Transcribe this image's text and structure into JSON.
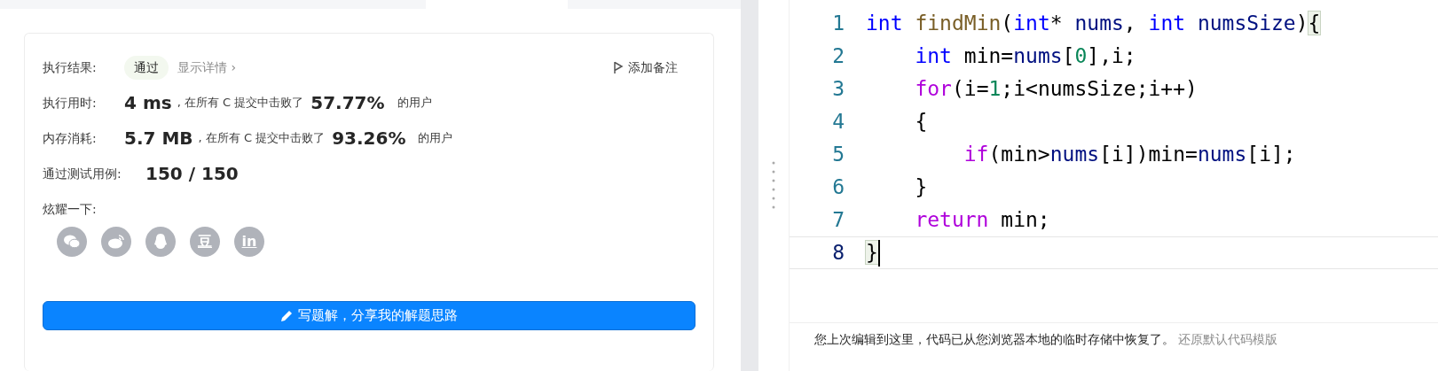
{
  "result": {
    "label": "执行结果:",
    "status": "通过",
    "details_link": "显示详情 ›",
    "add_note": "添加备注"
  },
  "stats": [
    {
      "label": "执行用时:",
      "value": "4 ms",
      "text": ", 在所有 C 提交中击败了",
      "percent": "57.77%",
      "suffix": "的用户"
    },
    {
      "label": "内存消耗:",
      "value": "5.7 MB",
      "text": ", 在所有 C 提交中击败了",
      "percent": "93.26%",
      "suffix": "的用户"
    }
  ],
  "tests": {
    "label": "通过测试用例:",
    "value": "150 / 150"
  },
  "share": {
    "label": "炫耀一下:",
    "icons": [
      {
        "kind": "wechat"
      },
      {
        "kind": "weibo"
      },
      {
        "kind": "qq"
      },
      {
        "kind": "douban",
        "glyph": "豆"
      },
      {
        "kind": "linkedin",
        "glyph": "in"
      }
    ]
  },
  "write_button": "写题解，分享我的解题思路",
  "editor": {
    "lines": [
      {
        "number": "1",
        "active": false,
        "tokens": [
          {
            "kind": "keyword",
            "text": "int"
          },
          {
            "kind": "function",
            "text": " findMin"
          },
          {
            "kind": "plain",
            "text": "("
          },
          {
            "kind": "keyword",
            "text": "int"
          },
          {
            "kind": "plain",
            "text": "* "
          },
          {
            "kind": "variable",
            "text": "nums"
          },
          {
            "kind": "plain",
            "text": ", "
          },
          {
            "kind": "keyword",
            "text": "int"
          },
          {
            "kind": "variable",
            "text": " numsSize"
          },
          {
            "kind": "plain",
            "text": ")"
          },
          {
            "kind": "bracket",
            "text": "{"
          }
        ]
      },
      {
        "number": "2",
        "active": false,
        "tokens": [
          {
            "kind": "keyword",
            "text": "    int"
          },
          {
            "kind": "plain",
            "text": " min="
          },
          {
            "kind": "variable",
            "text": "nums"
          },
          {
            "kind": "plain",
            "text": "["
          },
          {
            "kind": "number",
            "text": "0"
          },
          {
            "kind": "plain",
            "text": "],i;"
          }
        ]
      },
      {
        "number": "3",
        "active": false,
        "tokens": [
          {
            "kind": "control",
            "text": "    for"
          },
          {
            "kind": "plain",
            "text": "(i="
          },
          {
            "kind": "number",
            "text": "1"
          },
          {
            "kind": "plain",
            "text": ";i<numsSize;i++)"
          }
        ]
      },
      {
        "number": "4",
        "active": false,
        "tokens": [
          {
            "kind": "plain",
            "text": "    {"
          }
        ]
      },
      {
        "number": "5",
        "active": false,
        "tokens": [
          {
            "kind": "control",
            "text": "        if"
          },
          {
            "kind": "plain",
            "text": "(min>"
          },
          {
            "kind": "variable",
            "text": "nums"
          },
          {
            "kind": "plain",
            "text": "[i])min="
          },
          {
            "kind": "variable",
            "text": "nums"
          },
          {
            "kind": "plain",
            "text": "[i];"
          }
        ]
      },
      {
        "number": "6",
        "active": false,
        "tokens": [
          {
            "kind": "plain",
            "text": "    }"
          }
        ]
      },
      {
        "number": "7",
        "active": false,
        "tokens": [
          {
            "kind": "control",
            "text": "    return"
          },
          {
            "kind": "plain",
            "text": " min;"
          }
        ]
      },
      {
        "number": "8",
        "active": true,
        "tokens": [
          {
            "kind": "bracket",
            "text": "}"
          }
        ]
      }
    ]
  },
  "notice": {
    "text": "您上次编辑到这里，代码已从您浏览器本地的临时存储中恢复了。",
    "link": "还原默认代码模版"
  }
}
